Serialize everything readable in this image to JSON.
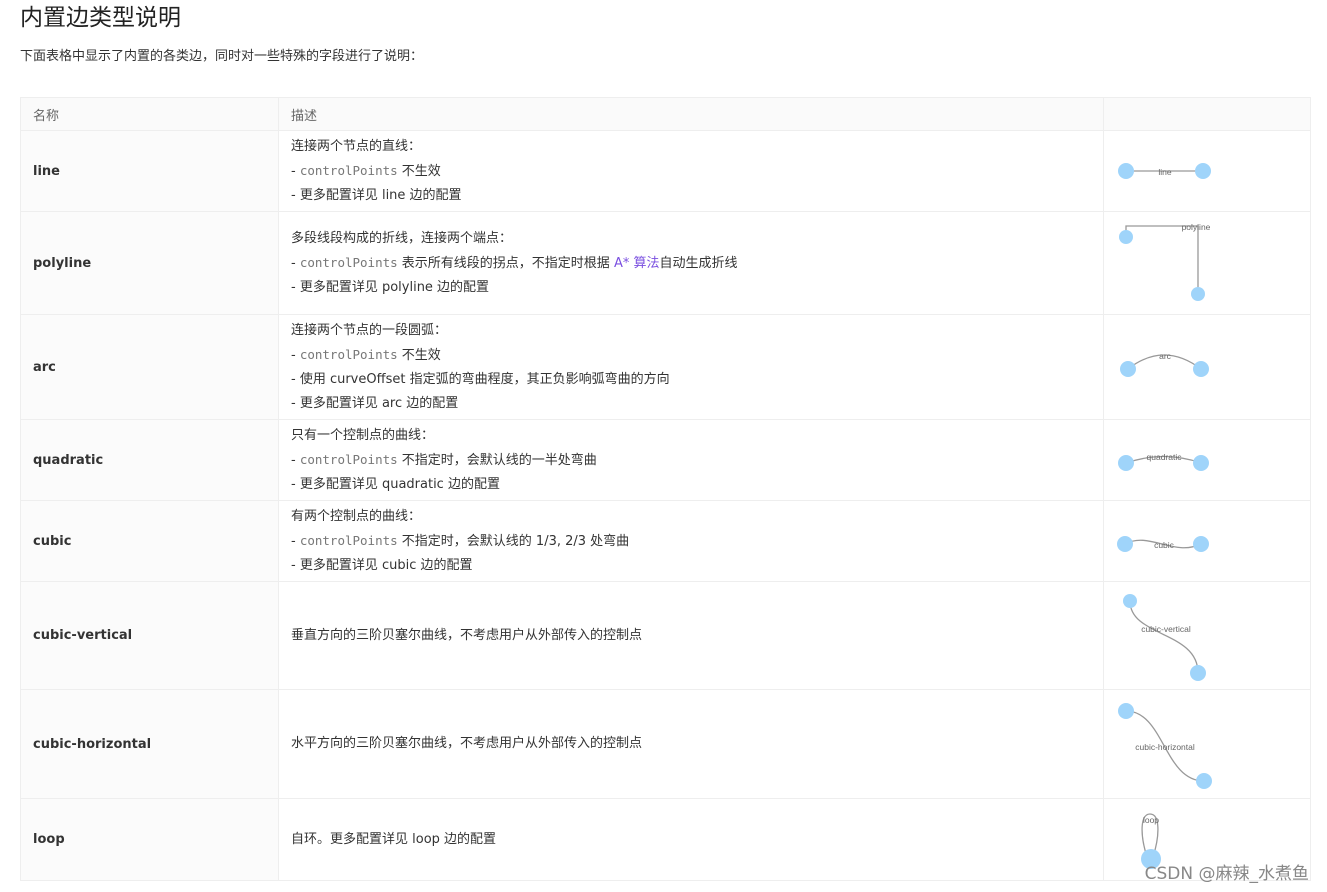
{
  "page": {
    "title": "内置边类型说明",
    "intro": "下面表格中显示了内置的各类边，同时对一些特殊的字段进行了说明："
  },
  "table": {
    "columns": [
      "名称",
      "描述",
      ""
    ],
    "rows": [
      {
        "name": "line",
        "lines": [
          {
            "text": "连接两个节点的直线："
          },
          {
            "prefix": "- ",
            "code": "controlPoints",
            "text": " 不生效"
          },
          {
            "text": "- 更多配置详见 line 边的配置"
          }
        ],
        "label": "line"
      },
      {
        "name": "polyline",
        "lines": [
          {
            "text": "多段线段构成的折线，连接两个端点："
          },
          {
            "prefix": "- ",
            "code": "controlPoints",
            "text": " 表示所有线段的拐点，不指定时根据 ",
            "link": "A* 算法",
            "suffix": "自动生成折线"
          },
          {
            "text": "- 更多配置详见 polyline 边的配置"
          }
        ],
        "label": "polyline"
      },
      {
        "name": "arc",
        "lines": [
          {
            "text": "连接两个节点的一段圆弧："
          },
          {
            "prefix": "- ",
            "code": "controlPoints",
            "text": " 不生效"
          },
          {
            "text": "- 使用 curveOffset 指定弧的弯曲程度，其正负影响弧弯曲的方向"
          },
          {
            "text": "- 更多配置详见 arc 边的配置"
          }
        ],
        "label": "arc"
      },
      {
        "name": "quadratic",
        "lines": [
          {
            "text": "只有一个控制点的曲线："
          },
          {
            "prefix": "- ",
            "code": "controlPoints",
            "text": " 不指定时，会默认线的一半处弯曲"
          },
          {
            "text": "- 更多配置详见 quadratic 边的配置"
          }
        ],
        "label": "quadratic"
      },
      {
        "name": "cubic",
        "lines": [
          {
            "text": "有两个控制点的曲线："
          },
          {
            "prefix": "- ",
            "code": "controlPoints",
            "text": " 不指定时，会默认线的 1/3, 2/3 处弯曲"
          },
          {
            "text": "- 更多配置详见 cubic 边的配置"
          }
        ],
        "label": "cubic"
      },
      {
        "name": "cubic-vertical",
        "lines": [
          {
            "text": "垂直方向的三阶贝塞尔曲线，不考虑用户从外部传入的控制点"
          }
        ],
        "label": "cubic-vertical"
      },
      {
        "name": "cubic-horizontal",
        "lines": [
          {
            "text": "水平方向的三阶贝塞尔曲线，不考虑用户从外部传入的控制点"
          }
        ],
        "label": "cubic-horizontal"
      },
      {
        "name": "loop",
        "lines": [
          {
            "text": "自环。更多配置详见 loop 边的配置"
          }
        ],
        "label": "loop"
      }
    ]
  },
  "colors": {
    "node": "#9fd4fa",
    "edge": "#999999",
    "link": "#7a4fe0"
  },
  "watermark": "CSDN @麻辣_水煮鱼"
}
